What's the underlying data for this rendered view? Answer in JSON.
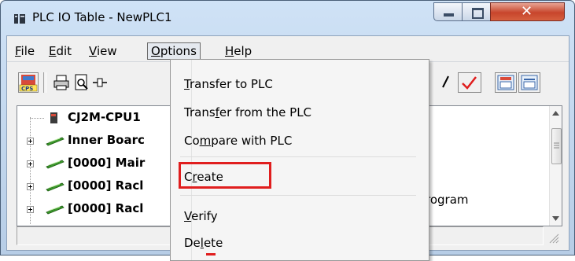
{
  "window": {
    "title": "PLC IO Table - NewPLC1"
  },
  "menubar": {
    "items": [
      {
        "pre": "",
        "u": "F",
        "post": "ile"
      },
      {
        "pre": "",
        "u": "E",
        "post": "dit"
      },
      {
        "pre": "",
        "u": "V",
        "post": "iew"
      },
      {
        "pre": "",
        "u": "O",
        "post": "ptions"
      },
      {
        "pre": "",
        "u": "H",
        "post": "elp"
      }
    ]
  },
  "tree": {
    "items": [
      {
        "label": "CJ2M-CPU1"
      },
      {
        "label": "Inner Boarc"
      },
      {
        "label": "[0000] Mair"
      },
      {
        "label": "[0000] Racl"
      },
      {
        "label": "[0000] Racl"
      }
    ]
  },
  "statusbar": {
    "text": "rogram"
  },
  "options_menu": {
    "items": [
      {
        "pre": "",
        "u": "T",
        "post": "ransfer to PLC"
      },
      {
        "pre": "Trans",
        "u": "f",
        "post": "er from the PLC"
      },
      {
        "pre": "Co",
        "u": "m",
        "post": "pare with PLC"
      },
      {
        "pre": "C",
        "u": "r",
        "post": "eate"
      },
      {
        "pre": "",
        "u": "V",
        "post": "erify"
      },
      {
        "pre": "De",
        "u": "l",
        "post": "ete"
      }
    ]
  },
  "colors": {
    "highlight": "#e01e1e",
    "title_bar": "#c4d8ef",
    "close_button": "#c7452c"
  },
  "icons": [
    "app-icon",
    "minimize-icon",
    "maximize-icon",
    "close-icon",
    "cps-icon",
    "print-icon",
    "preview-icon",
    "connector-icon",
    "checkmark-icon",
    "io-table-icon",
    "io-compare-icon",
    "cpu-icon",
    "board-icon"
  ]
}
